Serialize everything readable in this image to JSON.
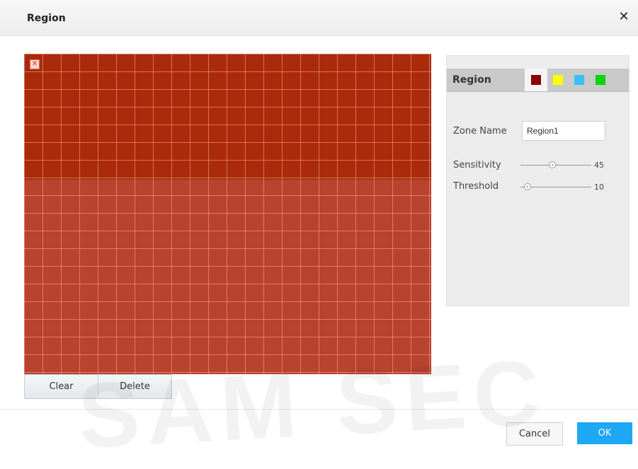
{
  "dialog": {
    "title": "Region",
    "close_icon": "close-icon"
  },
  "grid": {
    "selected_color": "#a92b0b",
    "fill_color": "#b8432f",
    "close_icon": "close-icon"
  },
  "buttons": {
    "clear_label": "Clear",
    "delete_label": "Delete",
    "cancel_label": "Cancel",
    "ok_label": "OK"
  },
  "panel": {
    "tab_label": "Region",
    "swatches": [
      {
        "name": "dark-red",
        "color": "#8b0000",
        "active": true
      },
      {
        "name": "yellow",
        "color": "#ffff00",
        "active": false
      },
      {
        "name": "light-blue",
        "color": "#39c0f5",
        "active": false
      },
      {
        "name": "green",
        "color": "#00d700",
        "active": false
      }
    ],
    "zone_name_label": "Zone Name",
    "zone_name_value": "Region1",
    "sensitivity_label": "Sensitivity",
    "sensitivity_value": "45",
    "threshold_label": "Threshold",
    "threshold_value": "10"
  },
  "watermark": "SAM SEC"
}
